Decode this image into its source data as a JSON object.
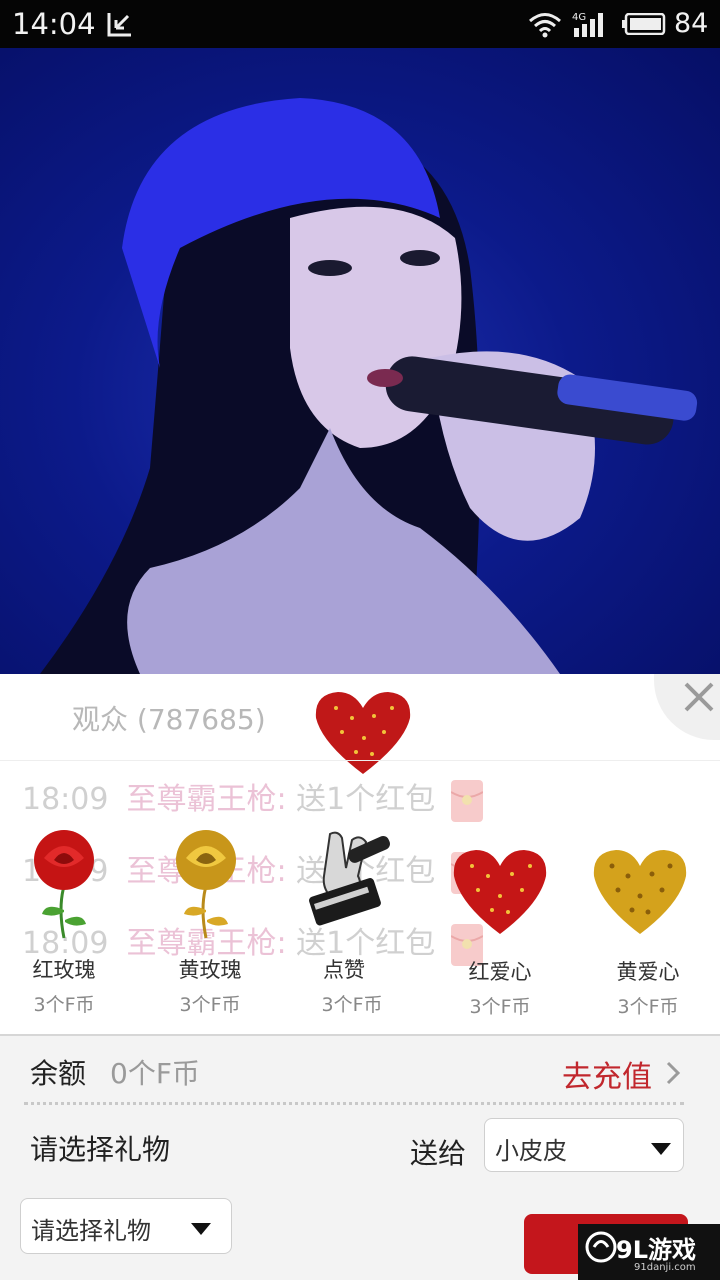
{
  "status_bar": {
    "time": "14:04",
    "network": "4G",
    "battery": "84"
  },
  "panel": {
    "audience_text": "观众 (787685)"
  },
  "chat": [
    {
      "time": "18:09",
      "user": "至尊霸王枪:",
      "message": "送1个红包"
    },
    {
      "time": "18:09",
      "user": "至尊霸王枪:",
      "message": "送1个红包"
    },
    {
      "time": "18:09",
      "user": "至尊霸王枪:",
      "message": "送1个红包"
    }
  ],
  "gifts": [
    {
      "name": "红玫瑰",
      "price": "3个F币",
      "icon": "red-rose-icon"
    },
    {
      "name": "黄玫瑰",
      "price": "3个F币",
      "icon": "yellow-rose-icon"
    },
    {
      "name": "点赞",
      "price": "3个F币",
      "icon": "voice-china-like-icon"
    },
    {
      "name": "红爱心",
      "price": "3个F币",
      "icon": "red-heart-icon"
    },
    {
      "name": "黄爱心",
      "price": "3个F币",
      "icon": "yellow-heart-icon"
    }
  ],
  "wallet": {
    "balance_label": "余额",
    "balance_value": "0个F币",
    "recharge_label": "去充值"
  },
  "gift_form": {
    "select_gift_label": "请选择礼物",
    "send_to_label": "送给",
    "recipient_value": "小皮皮",
    "gift_dropdown_value": "请选择礼物"
  },
  "watermark": {
    "main": "9L游戏",
    "sub": "91danji.com"
  },
  "colors": {
    "accent": "#c1272d",
    "send_button": "#c4161c",
    "video_bg": "#0c1a8a"
  }
}
